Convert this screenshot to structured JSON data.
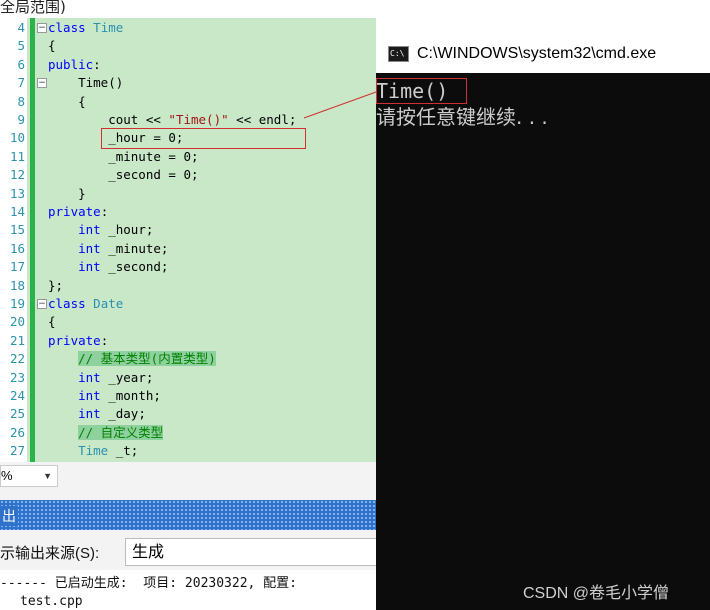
{
  "top_title": "全局范围)",
  "editor": {
    "lines": [
      {
        "no": "4",
        "fold": "−",
        "parts": [
          [
            "kw",
            "class"
          ],
          [
            "",
            " "
          ],
          [
            "ty",
            "Time"
          ]
        ]
      },
      {
        "no": "5",
        "fold": "",
        "parts": [
          [
            "",
            "{"
          ]
        ]
      },
      {
        "no": "6",
        "fold": "",
        "parts": [
          [
            "kw",
            "public"
          ],
          [
            "",
            ":"
          ]
        ]
      },
      {
        "no": "7",
        "fold": "−",
        "parts": [
          [
            "",
            "    Time()"
          ]
        ]
      },
      {
        "no": "8",
        "fold": "",
        "parts": [
          [
            "",
            "    {"
          ]
        ]
      },
      {
        "no": "9",
        "fold": "",
        "parts": [
          [
            "",
            "        cout << "
          ],
          [
            "st",
            "\"Time()\""
          ],
          [
            "",
            " << endl;"
          ]
        ]
      },
      {
        "no": "10",
        "fold": "",
        "parts": [
          [
            "",
            "        _hour = 0;"
          ]
        ]
      },
      {
        "no": "11",
        "fold": "",
        "parts": [
          [
            "",
            "        _minute = 0;"
          ]
        ]
      },
      {
        "no": "12",
        "fold": "",
        "parts": [
          [
            "",
            "        _second = 0;"
          ]
        ]
      },
      {
        "no": "13",
        "fold": "",
        "parts": [
          [
            "",
            "    }"
          ]
        ]
      },
      {
        "no": "14",
        "fold": "",
        "parts": [
          [
            "kw",
            "private"
          ],
          [
            "",
            ":"
          ]
        ]
      },
      {
        "no": "15",
        "fold": "",
        "parts": [
          [
            "",
            "    "
          ],
          [
            "kw",
            "int"
          ],
          [
            "",
            " _hour;"
          ]
        ]
      },
      {
        "no": "16",
        "fold": "",
        "parts": [
          [
            "",
            "    "
          ],
          [
            "kw",
            "int"
          ],
          [
            "",
            " _minute;"
          ]
        ]
      },
      {
        "no": "17",
        "fold": "",
        "parts": [
          [
            "",
            "    "
          ],
          [
            "kw",
            "int"
          ],
          [
            "",
            " _second;"
          ]
        ]
      },
      {
        "no": "18",
        "fold": "",
        "parts": [
          [
            "",
            "};"
          ]
        ]
      },
      {
        "no": "19",
        "fold": "−",
        "parts": [
          [
            "kw",
            "class"
          ],
          [
            "",
            " "
          ],
          [
            "ty",
            "Date"
          ]
        ]
      },
      {
        "no": "20",
        "fold": "",
        "parts": [
          [
            "",
            "{"
          ]
        ]
      },
      {
        "no": "21",
        "fold": "",
        "parts": [
          [
            "kw",
            "private"
          ],
          [
            "",
            ":"
          ]
        ]
      },
      {
        "no": "22",
        "fold": "",
        "parts": [
          [
            "",
            "    "
          ],
          [
            "cm",
            "// 基本类型(内置类型)"
          ]
        ]
      },
      {
        "no": "23",
        "fold": "",
        "parts": [
          [
            "",
            "    "
          ],
          [
            "kw",
            "int"
          ],
          [
            "",
            " _year;"
          ]
        ]
      },
      {
        "no": "24",
        "fold": "",
        "parts": [
          [
            "",
            "    "
          ],
          [
            "kw",
            "int"
          ],
          [
            "",
            " _month;"
          ]
        ]
      },
      {
        "no": "25",
        "fold": "",
        "parts": [
          [
            "",
            "    "
          ],
          [
            "kw",
            "int"
          ],
          [
            "",
            " _day;"
          ]
        ]
      },
      {
        "no": "26",
        "fold": "",
        "parts": [
          [
            "",
            "    "
          ],
          [
            "cm",
            "// 自定义类型"
          ]
        ]
      },
      {
        "no": "27",
        "fold": "",
        "parts": [
          [
            "",
            "    "
          ],
          [
            "ty",
            "Time"
          ],
          [
            "",
            " _t;"
          ]
        ]
      }
    ]
  },
  "zoom": {
    "value": "%"
  },
  "output_panel": {
    "title": "出",
    "source_label": "示输出来源(S):",
    "source_value": "生成",
    "line1": "------ 已启动生成:  项目: 20230322, 配置:",
    "line2": "test.cpp"
  },
  "cmd": {
    "title": "C:\\WINDOWS\\system32\\cmd.exe",
    "icon_text": "C:\\",
    "output_line1": "Time()",
    "output_line2": "请按任意键继续. . ."
  },
  "watermark": "CSDN @卷毛小学僧"
}
